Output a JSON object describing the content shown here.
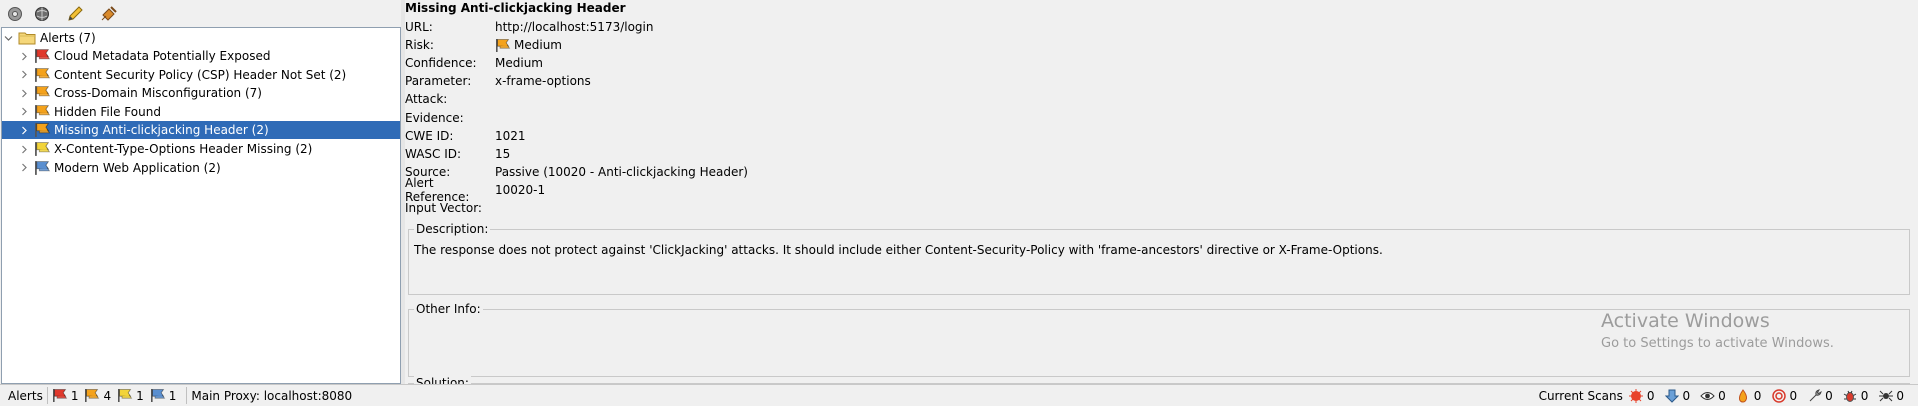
{
  "toolbar": {
    "buttons": [
      {
        "name": "settings-gear-icon"
      },
      {
        "name": "globe-icon"
      },
      {
        "name": "pencil-icon"
      },
      {
        "name": "broom-icon"
      }
    ]
  },
  "tree": {
    "root_label": "Alerts (7)",
    "items": [
      {
        "label": "Cloud Metadata Potentially Exposed",
        "risk": "high",
        "color": "#e0382c"
      },
      {
        "label": "Content Security Policy (CSP) Header Not Set (2)",
        "risk": "medium",
        "color": "#f4a21c"
      },
      {
        "label": "Cross-Domain Misconfiguration (7)",
        "risk": "medium",
        "color": "#f4a21c"
      },
      {
        "label": "Hidden File Found",
        "risk": "medium",
        "color": "#f4a21c"
      },
      {
        "label": "Missing Anti-clickjacking Header (2)",
        "risk": "medium",
        "color": "#f4a21c",
        "selected": true
      },
      {
        "label": "X-Content-Type-Options Header Missing (2)",
        "risk": "low",
        "color": "#f2d43a"
      },
      {
        "label": "Modern Web Application (2)",
        "risk": "info",
        "color": "#5a8fd0"
      }
    ]
  },
  "detail": {
    "title": "Missing Anti-clickjacking Header",
    "fields": [
      {
        "label": "URL:",
        "value": "http://localhost:5173/login"
      },
      {
        "label": "Risk:",
        "value": "Medium",
        "flag": "#f4a21c"
      },
      {
        "label": "Confidence:",
        "value": "Medium"
      },
      {
        "label": "Parameter:",
        "value": "x-frame-options"
      },
      {
        "label": "Attack:",
        "value": ""
      },
      {
        "label": "Evidence:",
        "value": ""
      },
      {
        "label": "CWE ID:",
        "value": "1021"
      },
      {
        "label": "WASC ID:",
        "value": "15"
      },
      {
        "label": "Source:",
        "value": "Passive (10020 - Anti-clickjacking Header)"
      },
      {
        "label": "Alert Reference:",
        "value": "10020-1"
      },
      {
        "label": "Input Vector:",
        "value": ""
      }
    ],
    "description_title": "Description:",
    "description": "The response does not protect against 'ClickJacking' attacks. It should include either Content-Security-Policy with 'frame-ancestors' directive or X-Frame-Options.",
    "other_info_title": "Other Info:",
    "other_info": "",
    "solution_title": "Solution:"
  },
  "watermark": {
    "line1": "Activate Windows",
    "line2": "Go to Settings to activate Windows."
  },
  "statusbar": {
    "alerts_label": "Alerts",
    "counts": [
      {
        "value": "1",
        "color": "#e0382c"
      },
      {
        "value": "4",
        "color": "#f4a21c"
      },
      {
        "value": "1",
        "color": "#f2d43a"
      },
      {
        "value": "1",
        "color": "#5a8fd0"
      }
    ],
    "proxy": "Main Proxy: localhost:8080",
    "current_scans_label": "Current Scans",
    "scans": [
      {
        "icon": "spider-burst-icon",
        "value": "0"
      },
      {
        "icon": "download-arrow-icon",
        "value": "0"
      },
      {
        "icon": "eye-icon",
        "value": "0"
      },
      {
        "icon": "flame-icon",
        "value": "0"
      },
      {
        "icon": "target-icon",
        "value": "0"
      },
      {
        "icon": "wrench-icon",
        "value": "0"
      },
      {
        "icon": "bug-icon",
        "value": "0"
      },
      {
        "icon": "spider-icon",
        "value": "0"
      }
    ]
  }
}
